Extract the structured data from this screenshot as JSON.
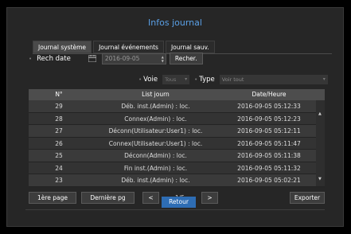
{
  "title": "Infos journal",
  "tabs": [
    {
      "label": "Journal système",
      "active": true
    },
    {
      "label": "Journal événements",
      "active": false
    },
    {
      "label": "Journal sauv.",
      "active": false
    }
  ],
  "search": {
    "label": "Rech date",
    "date_value": "2016-09-05",
    "button": "Recher."
  },
  "filters": {
    "voie_label": "Voie",
    "voie_value": "Tous",
    "type_label": "Type",
    "type_value": "Voir tout"
  },
  "table": {
    "headers": [
      "N°",
      "List journ",
      "Date/Heure"
    ],
    "rows": [
      [
        "29",
        "Déb. inst.(Admin) : loc.",
        "2016-09-05 05:12:33"
      ],
      [
        "28",
        "Connex(Admin) : loc.",
        "2016-09-05 05:12:23"
      ],
      [
        "27",
        "Déconn(Utilisateur:User1) : loc.",
        "2016-09-05 05:12:11"
      ],
      [
        "26",
        "Connex(Utilisateur:User1) : loc.",
        "2016-09-05 05:11:47"
      ],
      [
        "25",
        "Déconn(Admin) : loc.",
        "2016-09-05 05:11:38"
      ],
      [
        "24",
        "Fin inst.(Admin) : loc.",
        "2016-09-05 05:11:32"
      ],
      [
        "23",
        "Déb. inst.(Admin) : loc.",
        "2016-09-05 05:02:21"
      ]
    ]
  },
  "pager": {
    "first": "1ère page",
    "last": "Dernière pg",
    "prev": "<",
    "next": ">",
    "info": "1/5",
    "export": "Exporter"
  },
  "back": "Retour",
  "colors": {
    "accent": "#2e6db4",
    "title": "#5aa0e6"
  }
}
